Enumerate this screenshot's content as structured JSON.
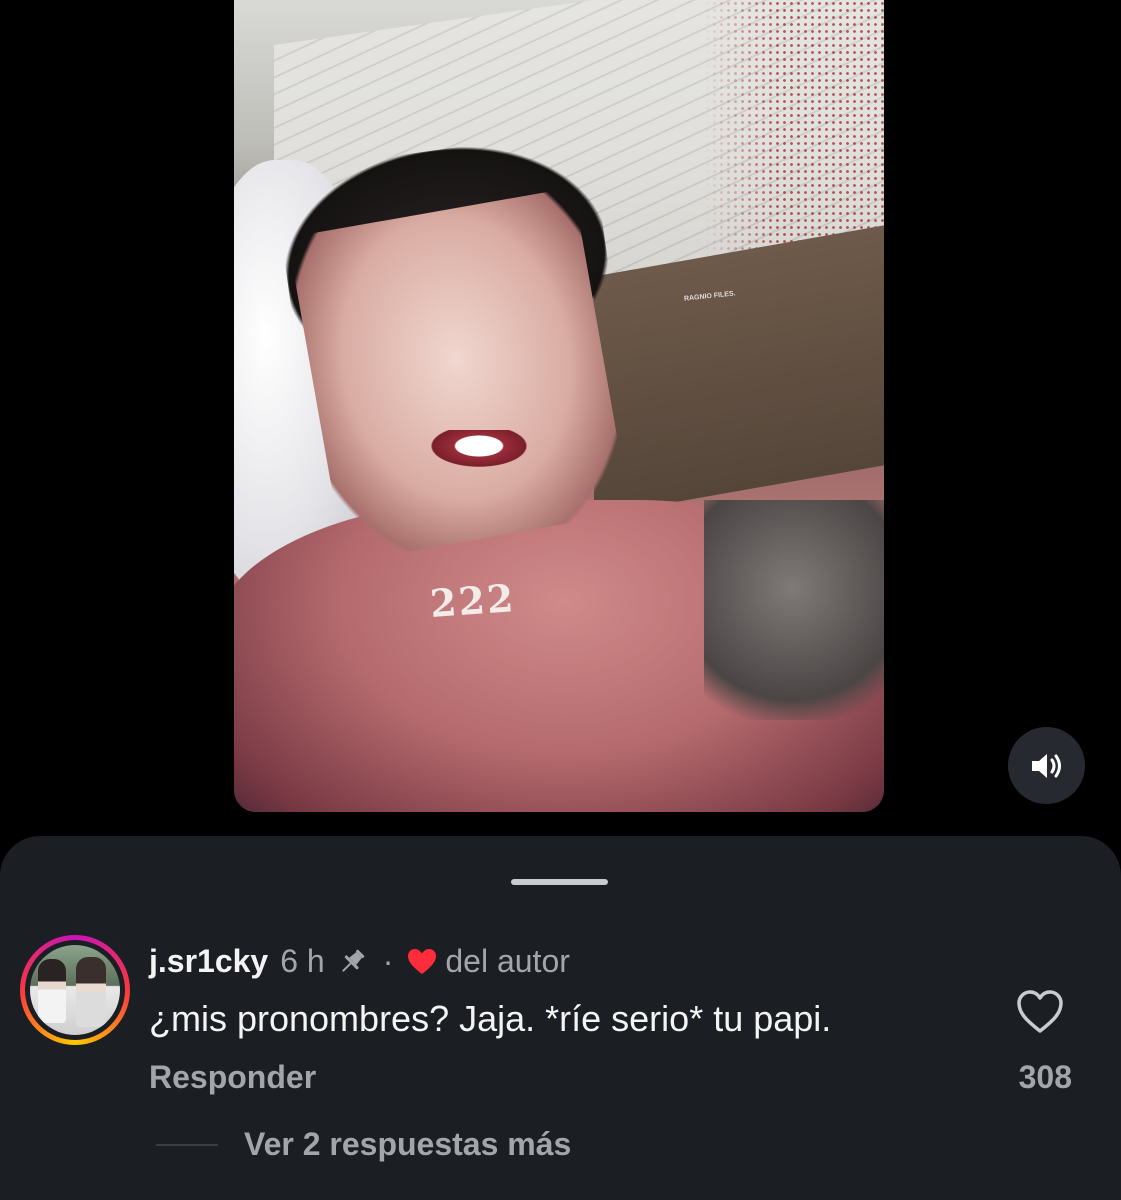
{
  "media": {
    "overlay_text": "222",
    "watermark": "RAGNIO FILES."
  },
  "controls": {
    "sound_icon": "speaker-on-icon"
  },
  "comment": {
    "username": "j.sr1cky",
    "time": "6 h",
    "separator": "·",
    "liked_by_author_label": "del autor",
    "text": "¿mis pronombres? Jaja. *ríe serio* tu papi.",
    "reply_label": "Responder",
    "like_count": "308",
    "view_replies_label": "Ver 2 respuestas más"
  },
  "colors": {
    "sheet_bg": "#1b1f24",
    "secondary_text": "#a2a6ab",
    "author_heart": "#ff2d3b"
  }
}
